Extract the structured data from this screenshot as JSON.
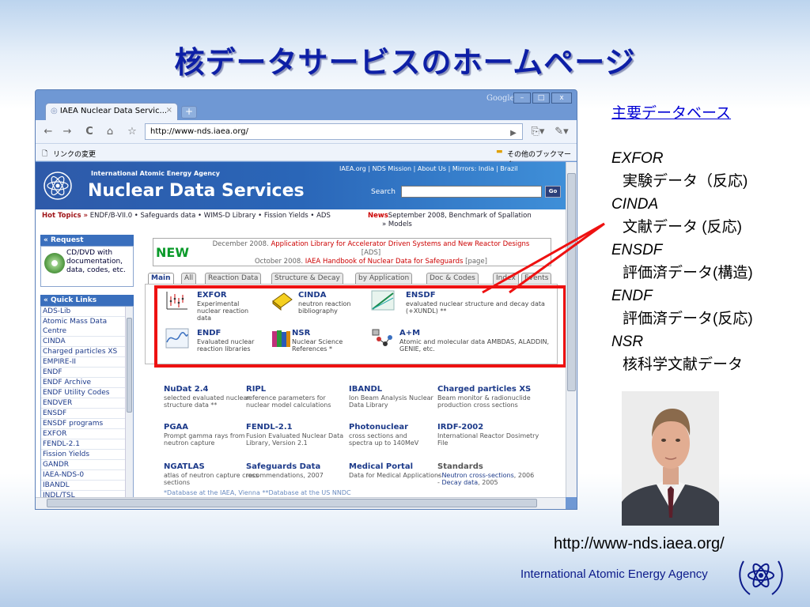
{
  "slide": {
    "title": "核データサービスのホームページ",
    "url": "http://www-nds.iaea.org/",
    "agency": "International Atomic Energy Agency"
  },
  "notes": {
    "heading": "主要データベース",
    "items": [
      {
        "code": "EXFOR",
        "desc": "実験データ（反応)"
      },
      {
        "code": "CINDA",
        "desc": "文献データ (反応)"
      },
      {
        "code": "ENSDF",
        "desc": "評価済データ(構造)"
      },
      {
        "code": "ENDF",
        "desc": "評価済データ(反応)"
      },
      {
        "code": "NSR",
        "desc": "核科学文献データ"
      }
    ]
  },
  "browser": {
    "tab_title": "IAEA Nuclear Data Servic...",
    "tab_close": "×",
    "new_tab": "+",
    "brand": "Google",
    "window_buttons": [
      "–",
      "□",
      "x"
    ],
    "nav": {
      "back": "←",
      "forward": "→",
      "reload": "C",
      "home": "⌂",
      "star": "☆",
      "go": "▶",
      "page": "⎘▾",
      "tools": "✎▾"
    },
    "url": "http://www-nds.iaea.org/",
    "bookmark_left": "リンクの変更",
    "bookmark_right": "その他のブックマーク"
  },
  "site": {
    "agency_small": "International Atomic Energy Agency",
    "title": "Nuclear Data Services",
    "top_links": "IAEA.org | NDS Mission | About Us | Mirrors: India | Brazil",
    "search_label": "Search",
    "go": "Go",
    "hot_topics_label": "Hot Topics »",
    "hot_topics": "ENDF/B-VII.0 • Safeguards data • WIMS-D Library • Fission Yields • ADS",
    "news_label": "News",
    "news": "September 2008, Benchmark of Spallation",
    "news_more": "» Models",
    "request": {
      "header": "« Request",
      "text": "CD/DVD with documentation, data, codes, etc."
    },
    "quick_links": {
      "header": "« Quick Links",
      "items": [
        "ADS-Lib",
        "Atomic Mass Data",
        "Centre",
        "CINDA",
        "Charged particles XS",
        "EMPIRE-II",
        "ENDF",
        "ENDF Archive",
        "ENDF Utility Codes",
        "ENDVER",
        "ENSDF",
        "ENSDF programs",
        "EXFOR",
        "FENDL-2.1",
        "Fission Yields",
        "GANDR",
        "IAEA-NDS-0",
        "IBANDL",
        "INDL/TSL"
      ]
    },
    "new_banner": {
      "word": "NEW",
      "line1_date": "December 2008.",
      "line1_text": "Application Library for Accelerator Driven Systems and New Reactor Designs",
      "line2": "[ADS]",
      "line3_date": "October 2008.",
      "line3_text": "IAEA Handbook of Nuclear Data for Safeguards",
      "line3_tail": "[page]"
    },
    "tabs": [
      "Main",
      "All",
      "Reaction Data",
      "Structure & Decay",
      "by Application",
      "Doc & Codes",
      "Index",
      "Events"
    ],
    "core_dbs": [
      {
        "name": "EXFOR",
        "desc": "Experimental nuclear reaction data"
      },
      {
        "name": "CINDA",
        "desc": "neutron reaction bibliography"
      },
      {
        "name": "ENSDF",
        "desc": "evaluated nuclear structure and decay data (+XUNDL) **"
      },
      {
        "name": "ENDF",
        "desc": "Evaluated nuclear reaction libraries"
      },
      {
        "name": "NSR",
        "desc": "Nuclear Science References *"
      },
      {
        "name": "A+M",
        "desc": "Atomic and molecular data AMBDAS, ALADDIN, GENIE, etc."
      }
    ],
    "resources": [
      {
        "name": "NuDat 2.4",
        "desc": "selected evaluated nuclear structure data **"
      },
      {
        "name": "RIPL",
        "desc": "reference parameters for nuclear model calculations"
      },
      {
        "name": "IBANDL",
        "desc": "Ion Beam Analysis Nuclear Data Library"
      },
      {
        "name": "Charged particles XS",
        "desc": "Beam monitor & radionuclide production cross sections"
      },
      {
        "name": "PGAA",
        "desc": "Prompt gamma rays from neutron capture"
      },
      {
        "name": "FENDL-2.1",
        "desc": "Fusion Evaluated Nuclear Data Library, Version 2.1"
      },
      {
        "name": "Photonuclear",
        "desc": "cross sections and spectra up to 140MeV"
      },
      {
        "name": "IRDF-2002",
        "desc": "International Reactor Dosimetry File"
      },
      {
        "name": "NGATLAS",
        "desc": "atlas of neutron capture cross sections"
      },
      {
        "name": "Safeguards Data",
        "desc": "recommendations, 2007"
      },
      {
        "name": "Medical Portal",
        "desc": "Data for Medical Applications"
      }
    ],
    "standards": {
      "name": "Standards",
      "line1_link": "Neutron cross-sections",
      "line1_year": ", 2006",
      "line2_link": "Decay data",
      "line2_year": ", 2005"
    },
    "footnote": "*Database at the IAEA, Vienna    **Database at the US NNDC"
  },
  "colors": {
    "title": "#0d1fa6",
    "highlight": "#ee1111",
    "site_header": "#2a66b8",
    "link": "#1c3a8a"
  }
}
